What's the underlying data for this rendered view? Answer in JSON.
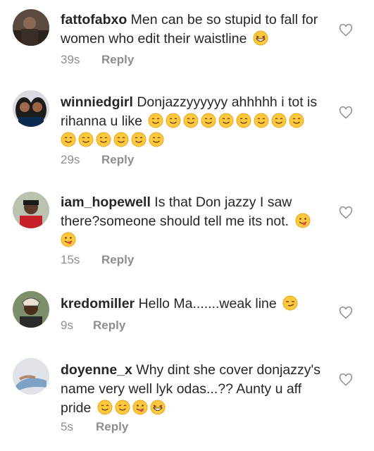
{
  "comments": [
    {
      "username": "fattofabxo",
      "text": "Men can be so stupid to fall for women who edit their waistline",
      "time": "39s",
      "reply": "Reply",
      "emojis": [
        "grinning-squint-face"
      ]
    },
    {
      "username": "winniedgirl",
      "text": "Donjazzyyyyyy ahhhhh i tot is rihanna u like",
      "time": "29s",
      "reply": "Reply",
      "emojis": [
        "smiling-face",
        "smiling-face",
        "smiling-face",
        "smiling-face",
        "smiling-face",
        "smiling-face",
        "smiling-face",
        "smiling-face",
        "smiling-face",
        "smiling-face",
        "smiling-face",
        "smiling-face",
        "smiling-face",
        "smiling-face",
        "smiling-face"
      ]
    },
    {
      "username": "iam_hopewell",
      "text": "Is that Don jazzy I saw there?someone should tell me its not.",
      "time": "15s",
      "reply": "Reply",
      "emojis": [
        "face-savoring-food",
        "face-savoring-food"
      ]
    },
    {
      "username": "kredomiller",
      "text": "Hello Ma.......weak line",
      "time": "9s",
      "reply": "Reply",
      "emojis": [
        "smirking-face"
      ]
    },
    {
      "username": "doyenne_x",
      "text": "Why dint she cover donjazzy's name very well lyk odas...?? Aunty u aff pride",
      "time": "5s",
      "reply": "Reply",
      "emojis": [
        "smiling-face",
        "smiling-face",
        "face-savoring-food",
        "grinning-squint-face"
      ]
    }
  ],
  "colors": {
    "text": "#262626",
    "meta": "#8e8e8e",
    "emoji_yellow": "#ffc83d"
  }
}
